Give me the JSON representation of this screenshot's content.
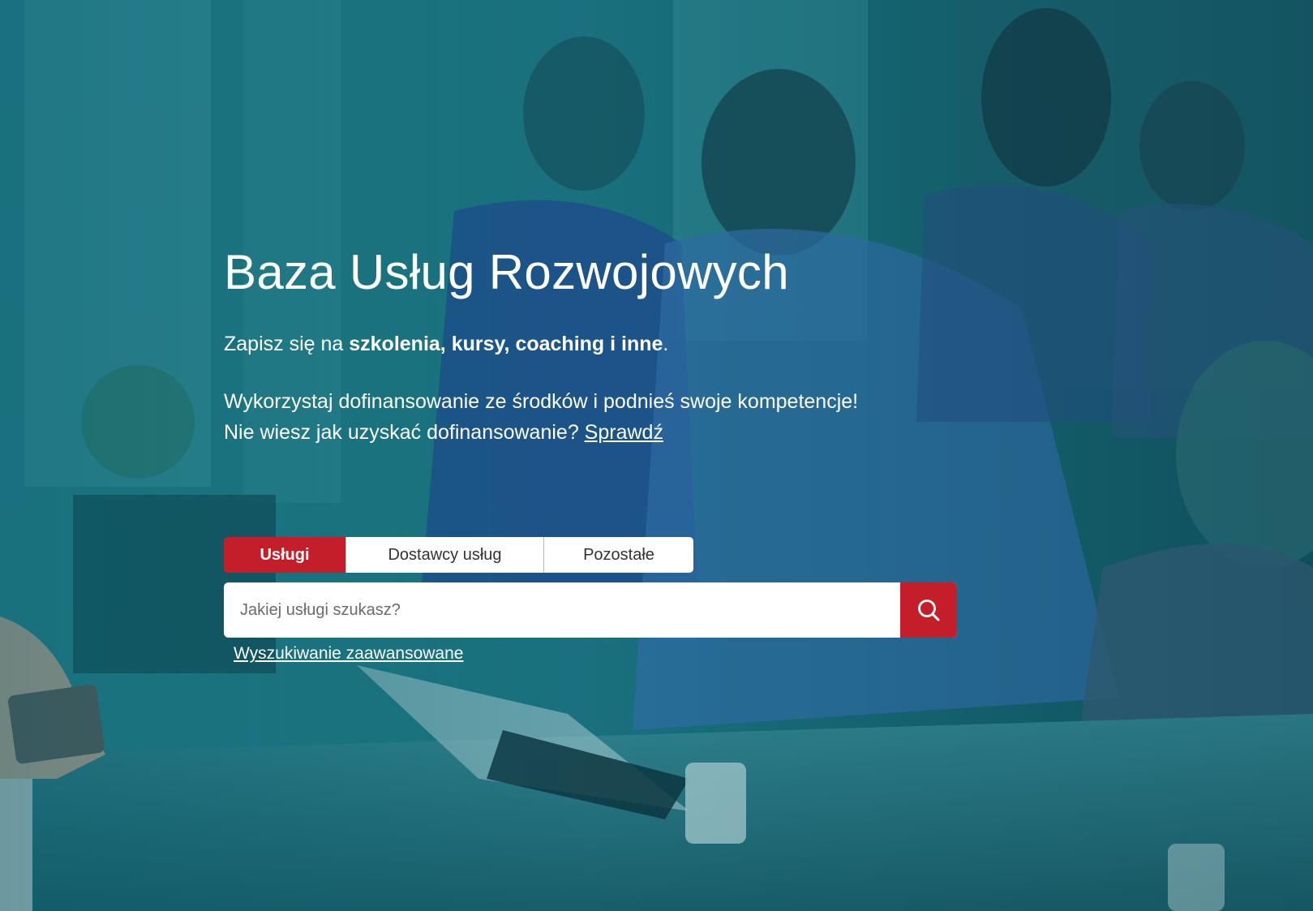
{
  "hero": {
    "title": "Baza Usług Rozwojowych",
    "lead_prefix": "Zapisz się na ",
    "lead_bold": "szkolenia, kursy, coaching i inne",
    "lead_suffix": ".",
    "info_line1": "Wykorzystaj dofinansowanie ze środków i podnieś swoje kompetencje!",
    "info_line2_prefix": "Nie wiesz jak uzyskać dofinansowanie? ",
    "info_link": "Sprawdź"
  },
  "tabs": [
    {
      "label": "Usługi",
      "active": true
    },
    {
      "label": "Dostawcy usług",
      "active": false
    },
    {
      "label": "Pozostałe",
      "active": false
    }
  ],
  "search": {
    "placeholder": "Jakiej usługi szukasz?",
    "button_icon": "search-icon",
    "advanced_link": "Wyszukiwanie zaawansowane"
  },
  "colors": {
    "accent": "#c41e2b",
    "overlay": "#0f5a66",
    "text": "#ffffff"
  }
}
